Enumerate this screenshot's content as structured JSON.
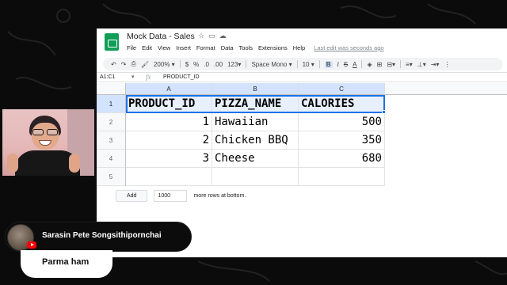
{
  "document": {
    "title": "Mock Data - Sales",
    "last_edit": "Last edit was seconds ago"
  },
  "menu": [
    "File",
    "Edit",
    "View",
    "Insert",
    "Format",
    "Data",
    "Tools",
    "Extensions",
    "Help"
  ],
  "toolbar": {
    "undo_icon": "undo-icon",
    "redo_icon": "redo-icon",
    "print_icon": "print-icon",
    "paint_format_icon": "paint-format-icon",
    "zoom": "200%",
    "currency": "$",
    "percent": "%",
    "decrease_decimal": ".0",
    "increase_decimal": ".00",
    "more_formats": "123",
    "font": "Space Mono",
    "font_size": "10",
    "bold": "B",
    "italic": "I",
    "strikethrough": "S",
    "text_color": "A",
    "accent_color": "#1a73e8"
  },
  "formula_bar": {
    "cell_ref": "A1:C1",
    "fx": "fx",
    "value": "PRODUCT_ID"
  },
  "grid": {
    "columns": [
      "A",
      "B",
      "C"
    ],
    "row_numbers": [
      "1",
      "2",
      "3",
      "4",
      "5"
    ],
    "header": [
      "PRODUCT_ID",
      "PIZZA_NAME",
      "CALORIES"
    ],
    "rows": [
      [
        "1",
        "Hawaiian",
        "500"
      ],
      [
        "2",
        "Chicken BBQ",
        "350"
      ],
      [
        "3",
        "Cheese",
        "680"
      ]
    ]
  },
  "add_rows": {
    "button": "Add",
    "count": "1000",
    "label": "more rows at bottom."
  },
  "chat": {
    "author": "Sarasin Pete Songsithipornchai",
    "message": "Parma ham"
  }
}
